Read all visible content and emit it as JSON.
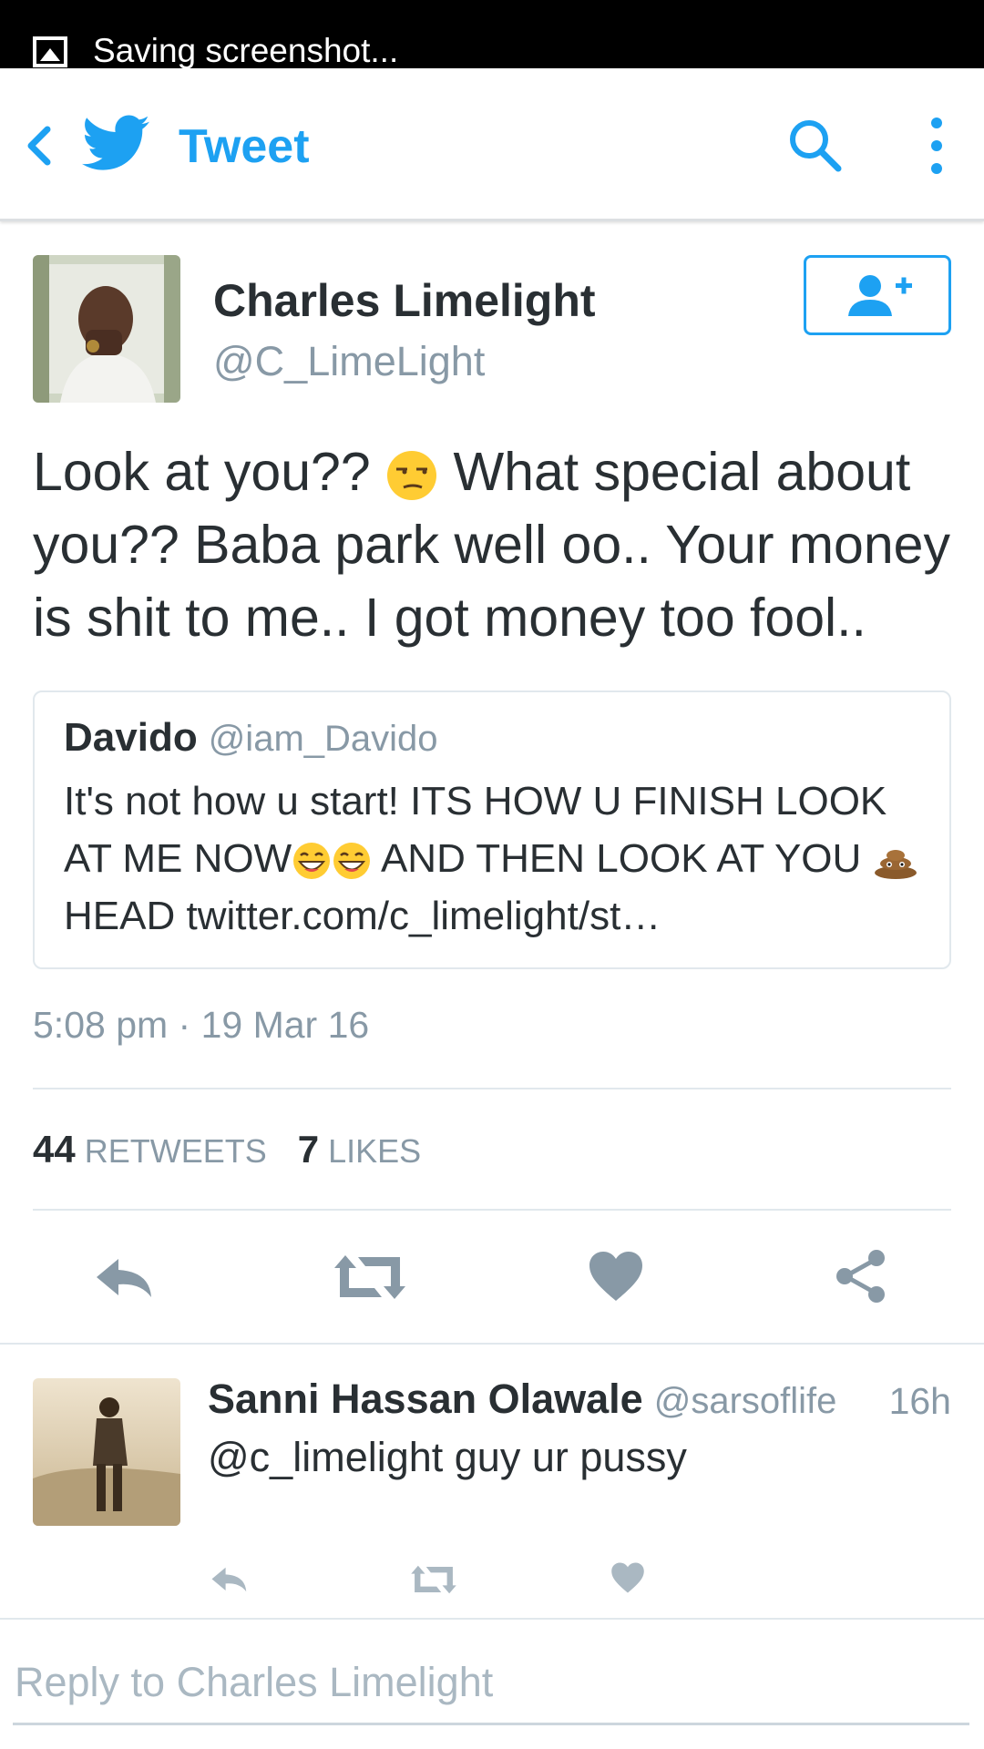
{
  "status_bar": {
    "notification": "Saving screenshot..."
  },
  "app_bar": {
    "title": "Tweet",
    "icons": [
      "back-icon",
      "twitter-bird-icon",
      "search-icon",
      "more-vert-icon"
    ]
  },
  "tweet": {
    "author_name": "Charles Limelight",
    "author_handle": "@C_LimeLight",
    "text_part1": "Look at you?? ",
    "text_part2": " What special about you?? Baba park well oo.. Your money is shit to me.. I got money too fool..",
    "quoted": {
      "author_name": "Davido",
      "author_handle": "@iam_Davido",
      "text_part1": "It's not how u start! ITS HOW U FINISH LOOK AT ME NOW",
      "text_part2": " AND THEN LOOK AT YOU ",
      "text_part3": " HEAD ",
      "link": "twitter.com/c_limelight/st…"
    },
    "timestamp": "5:08 pm · 19 Mar 16",
    "retweets_count": "44",
    "retweets_label": "RETWEETS",
    "likes_count": "7",
    "likes_label": "LIKES"
  },
  "reply": {
    "author_name": "Sanni Hassan Olawale",
    "author_handle": "@sarsoflife",
    "time": "16h",
    "text": "@c_limelight guy ur pussy"
  },
  "reply_box": {
    "placeholder": "Reply to Charles Limelight"
  },
  "colors": {
    "brand": "#1da1f2",
    "action_gray": "#8899a6",
    "text": "#292f33",
    "muted": "#8899a6"
  }
}
